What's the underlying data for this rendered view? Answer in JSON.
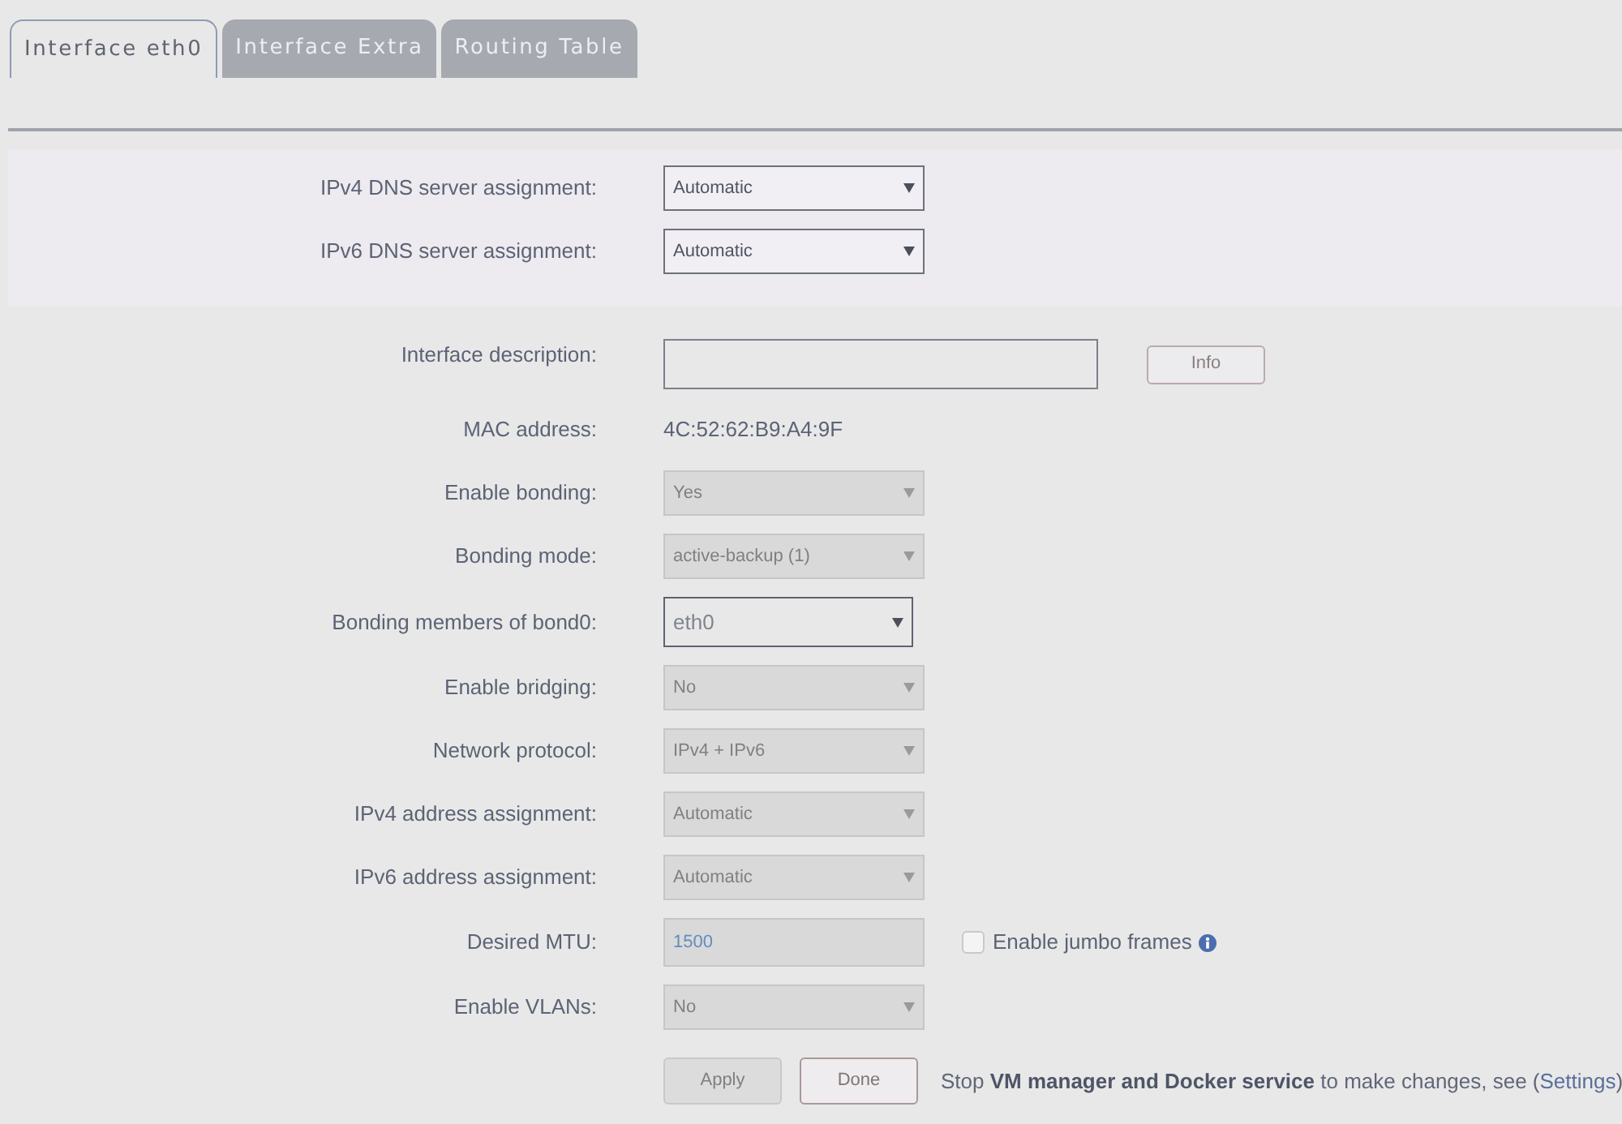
{
  "tabs": [
    {
      "label": "Interface eth0",
      "selected": true
    },
    {
      "label": "Interface Extra",
      "selected": false
    },
    {
      "label": "Routing Table",
      "selected": false
    }
  ],
  "dns_section": {
    "rows": [
      {
        "kind": "select",
        "label": "IPv4 DNS server assignment:",
        "value": "Automatic",
        "disabled": false
      },
      {
        "kind": "select",
        "label": "IPv6 DNS server assignment:",
        "value": "Automatic",
        "disabled": false
      }
    ]
  },
  "settings": {
    "rows": [
      {
        "kind": "text",
        "label": "Interface description:",
        "button": "Info"
      },
      {
        "kind": "static",
        "label": "MAC address:",
        "value": "4C:52:62:B9:A4:9F"
      },
      {
        "kind": "select",
        "label": "Enable bonding:",
        "value": "Yes",
        "disabled": true
      },
      {
        "kind": "select",
        "label": "Bonding mode:",
        "value": "active-backup (1)",
        "disabled": true
      },
      {
        "kind": "multiselect",
        "label": "Bonding members of bond0:",
        "value": "eth0"
      },
      {
        "kind": "select",
        "label": "Enable bridging:",
        "value": "No",
        "disabled": true
      },
      {
        "kind": "select",
        "label": "Network protocol:",
        "value": "IPv4 + IPv6",
        "disabled": true
      },
      {
        "kind": "select",
        "label": "IPv4 address assignment:",
        "value": "Automatic",
        "disabled": true
      },
      {
        "kind": "select",
        "label": "IPv6 address assignment:",
        "value": "Automatic",
        "disabled": true
      },
      {
        "kind": "number",
        "label": "Desired MTU:",
        "value": "1500",
        "disabled": true,
        "checkbox": {
          "label": "Enable jumbo frames",
          "checked": false
        }
      },
      {
        "kind": "select",
        "label": "Enable VLANs:",
        "value": "No",
        "disabled": true
      }
    ]
  },
  "actions": {
    "buttons": [
      {
        "label": "Apply",
        "disabled": true
      },
      {
        "label": "Done",
        "disabled": false
      }
    ],
    "notice": {
      "text": "Stop **VM manager and Docker service** to make changes, see (",
      "link": "Settings",
      "text_end": ")"
    }
  }
}
